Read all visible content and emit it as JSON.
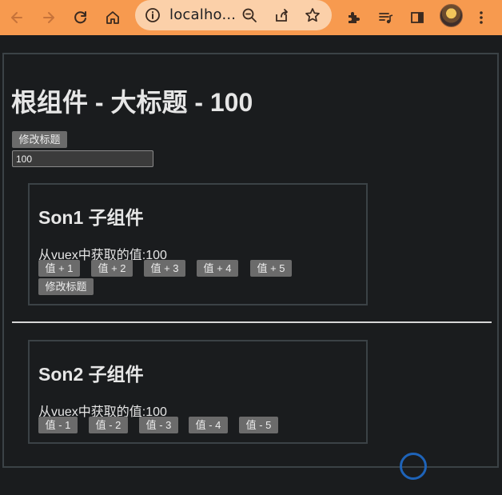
{
  "browser": {
    "address": "localho...",
    "icons": [
      "back-icon",
      "forward-icon",
      "reload-icon",
      "home-icon",
      "info-icon",
      "zoom-icon",
      "share-icon",
      "star-icon",
      "extensions-icon",
      "media-icon",
      "sidepanel-icon",
      "avatar",
      "menu-icon"
    ],
    "toolbar_color": "#f79a4f"
  },
  "root": {
    "title": "根组件 - 大标题 - 100",
    "edit_button": "修改标题",
    "input_value": "100"
  },
  "son1": {
    "title": "Son1 子组件",
    "value_text": "从vuex中获取的值:100",
    "buttons": [
      "值 + 1",
      "值 + 2",
      "值 + 3",
      "值 + 4",
      "值 + 5"
    ],
    "edit_button": "修改标题"
  },
  "son2": {
    "title": "Son2 子组件",
    "value_text": "从vuex中获取的值:100",
    "buttons": [
      "值 - 1",
      "值 - 2",
      "值 - 3",
      "值 - 4",
      "值 - 5"
    ]
  }
}
